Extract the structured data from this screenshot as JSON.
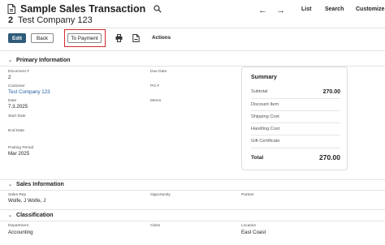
{
  "header": {
    "title": "Sample Sales Transaction",
    "number": "2",
    "company": "Test Company 123",
    "nav_prev": "←",
    "nav_next": "→",
    "links": [
      "List",
      "Search",
      "Customize"
    ]
  },
  "toolbar": {
    "edit_label": "Edit",
    "back_label": "Back",
    "payment_label": "To Payment",
    "actions_label": "Actions"
  },
  "primary": {
    "section_title": "Primary Information",
    "fields": {
      "document_label": "Document #",
      "document_value": "2",
      "customer_label": "Customer",
      "customer_value": "Test Company 123",
      "date_label": "Date",
      "date_value": "7.3.2025",
      "start_date_label": "Start Date",
      "end_date_label": "End Date",
      "posting_period_label": "Posting Period",
      "posting_period_value": "Mar 2025",
      "due_date_label": "Due Date",
      "po_label": "PO #",
      "memo_label": "Memo"
    }
  },
  "summary": {
    "title": "Summary",
    "rows": [
      {
        "label": "Subtotal",
        "value": "270.00"
      },
      {
        "label": "Discount Item",
        "value": ""
      },
      {
        "label": "Shipping Cost",
        "value": ""
      },
      {
        "label": "Handling Cost",
        "value": ""
      },
      {
        "label": "Gift Certificate",
        "value": ""
      }
    ],
    "total_label": "Total",
    "total_value": "270.00"
  },
  "sales": {
    "section_title": "Sales Information",
    "sales_rep_label": "Sales Rep",
    "sales_rep_value": "Wolfe, J Wolfe, J",
    "opportunity_label": "Opportunity",
    "partner_label": "Partner"
  },
  "classification": {
    "section_title": "Classification",
    "department_label": "Department",
    "department_value": "Accounting",
    "class_label": "Class",
    "location_label": "Location",
    "location_value": "East Coast"
  }
}
